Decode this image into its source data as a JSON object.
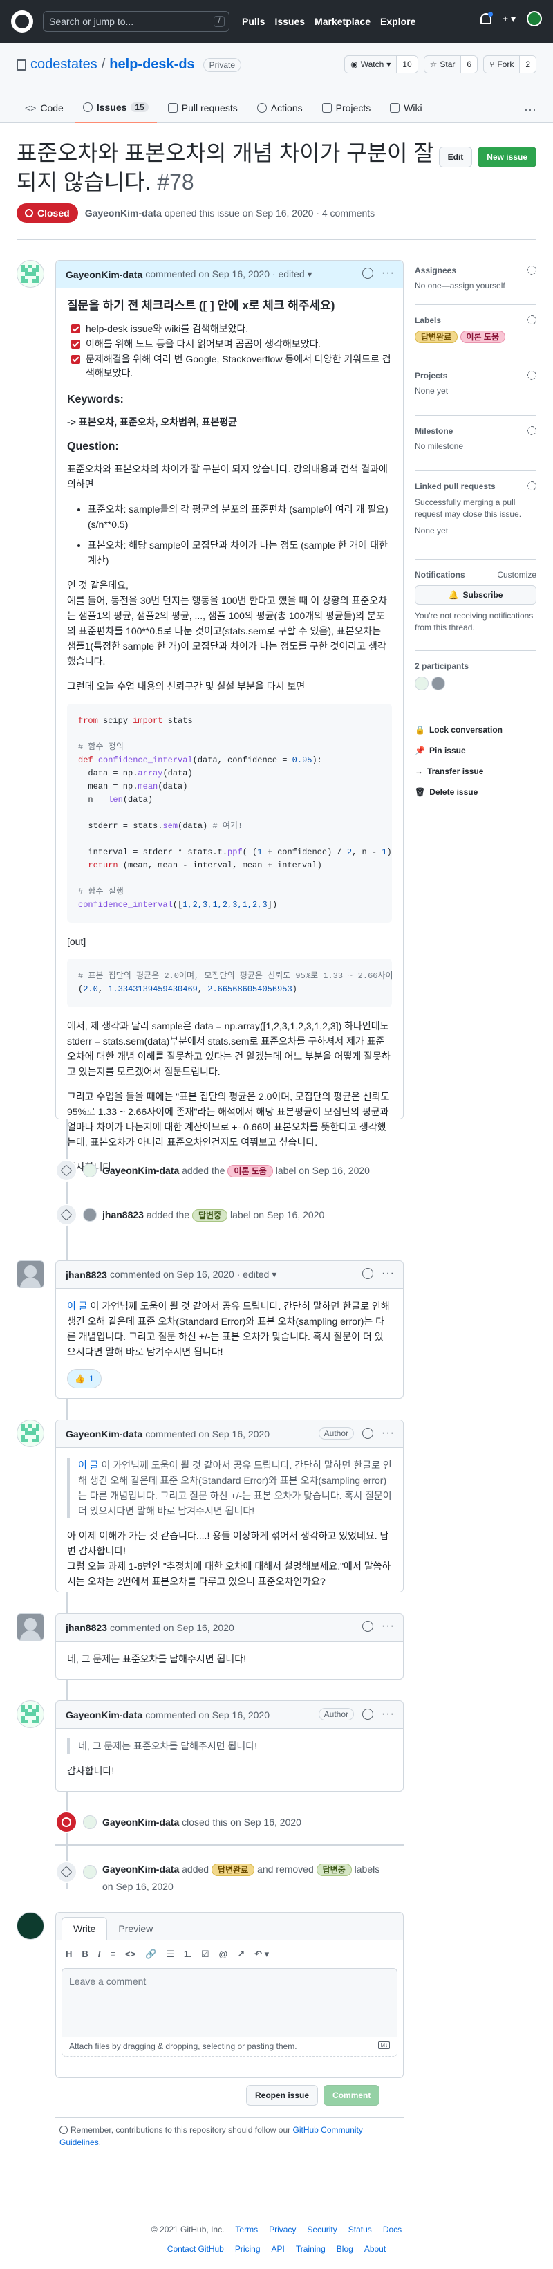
{
  "header": {
    "search_placeholder": "Search or jump to...",
    "slash": "/",
    "nav": [
      "Pulls",
      "Issues",
      "Marketplace",
      "Explore"
    ],
    "plus": "+ ▾"
  },
  "repo": {
    "owner": "codestates",
    "sep": "/",
    "name": "help-desk-ds",
    "visibility": "Private",
    "watch": "Watch",
    "watch_count": "10",
    "star": "Star",
    "star_count": "6",
    "fork": "Fork",
    "fork_count": "2",
    "tabs": [
      {
        "label": "Code"
      },
      {
        "label": "Issues",
        "count": "15"
      },
      {
        "label": "Pull requests"
      },
      {
        "label": "Actions"
      },
      {
        "label": "Projects"
      },
      {
        "label": "Wiki"
      }
    ],
    "more": "···"
  },
  "issue": {
    "title": "표준오차와 표본오차의 개념 차이가 구분이 잘 되지 않습니다.",
    "number": "#78",
    "edit": "Edit",
    "new_issue": "New issue",
    "state": "Closed",
    "opened_by": "GayeonKim-data",
    "opened_text": "opened this issue on Sep 16, 2020 · 4 comments"
  },
  "comments": [
    {
      "author": "GayeonKim-data",
      "meta": "commented on Sep 16, 2020 · edited ▾",
      "checklist_title": "질문을 하기 전 체크리스트 ([ ] 안에 x로 체크 해주세요)",
      "checklist": [
        "help-desk issue와 wiki를 검색해보았다.",
        "이해를 위해 노트 등을 다시 읽어보며 곰곰이 생각해보았다.",
        "문제해결을 위해 여러 번 Google, Stackoverflow 등에서 다양한 키워드로 검색해보았다."
      ],
      "kw_head": "Keywords:",
      "keywords": "-> 표본오차, 표준오차, 오차범위, 표본평균",
      "q_head": "Question:",
      "q1": "표준오차와 표본오차의 차이가 잘 구분이 되지 않습니다. 강의내용과 검색 결과에 의하면",
      "bullets": [
        "표준오차: sample들의 각 평균의 분포의 표준편차 (sample이 여러 개 필요) (s/n**0.5)",
        "표본오차: 해당 sample이 모집단과 차이가 나는 정도 (sample 한 개에 대한 계산)"
      ],
      "q2": "인 것 같은데요,\n예를 들어, 동전을 30번 던지는 행동을 100번 한다고 했을 때 이 상황의 표준오차는 샘플1의 평균, 샘플2의 평균, ..., 샘플 100의 평균(총 100개의 평균들)의 분포의 표준편차를 100**0.5로 나눈 것이고(stats.sem로 구할 수 있음), 표본오차는 샘플1(특정한 sample 한 개)이 모집단과 차이가 나는 정도를 구한 것이라고 생각했습니다.",
      "q3": "그런데 오늘 수업 내용의 신뢰구간 및 실설 부분을 다시 보면",
      "code": [
        [
          [
            "kw",
            "from "
          ],
          [
            "",
            "scipy "
          ],
          [
            "kw",
            "import "
          ],
          [
            "",
            "stats"
          ]
        ],
        [],
        [
          [
            "cm",
            "# 함수 정의"
          ]
        ],
        [
          [
            "kw",
            "def "
          ],
          [
            "fn",
            "confidence_interval"
          ],
          [
            "",
            "(data, confidence = "
          ],
          [
            "nm",
            "0.95"
          ],
          [
            "",
            "):"
          ]
        ],
        [
          [
            "",
            "  data = np."
          ],
          [
            "fn",
            "array"
          ],
          [
            "",
            "(data)"
          ]
        ],
        [
          [
            "",
            "  mean = np."
          ],
          [
            "fn",
            "mean"
          ],
          [
            "",
            "(data)"
          ]
        ],
        [
          [
            "",
            "  n = "
          ],
          [
            "fn",
            "len"
          ],
          [
            "",
            "(data)"
          ]
        ],
        [],
        [
          [
            "",
            "  stderr = stats."
          ],
          [
            "fn",
            "sem"
          ],
          [
            "",
            "(data) "
          ],
          [
            "cm",
            "# 여기!"
          ]
        ],
        [],
        [
          [
            "",
            "  interval = stderr * stats.t."
          ],
          [
            "fn",
            "ppf"
          ],
          [
            "",
            "( ("
          ],
          [
            "nm",
            "1"
          ],
          [
            "",
            " + confidence) / "
          ],
          [
            "nm",
            "2"
          ],
          [
            "",
            ", n - "
          ],
          [
            "nm",
            "1"
          ],
          [
            "",
            ")"
          ]
        ],
        [
          [
            "kw",
            "  return "
          ],
          [
            "",
            "(mean, mean - interval, mean + interval)"
          ]
        ],
        [],
        [
          [
            "cm",
            "# 함수 실행"
          ]
        ],
        [
          [
            "fn",
            "confidence_interval"
          ],
          [
            "",
            "(["
          ],
          [
            "nm",
            "1,2,3,1,2,3,1,2,3"
          ],
          [
            "",
            "])"
          ]
        ]
      ],
      "out_label": "[out]",
      "out_code": [
        [
          [
            "cm",
            "# 표본 집단의 평균은 2.0이며, 모집단의 평균은 신뢰도 95%로 1.33 ~ 2.66사이에"
          ]
        ],
        [
          [
            "",
            "("
          ],
          [
            "nm",
            "2.0"
          ],
          [
            "",
            ", "
          ],
          [
            "nm",
            "1.3343139459430469"
          ],
          [
            "",
            ", "
          ],
          [
            "nm",
            "2.665686054056953"
          ],
          [
            "",
            ")"
          ]
        ]
      ],
      "q4": "에서, 제 생각과 달리 sample은 data = np.array([1,2,3,1,2,3,1,2,3]) 하나인데도 stderr = stats.sem(data)부분에서 stats.sem로 표준오차를 구하셔서 제가 표준오차에 대한 개념 이해를 잘못하고 있다는 건 알겠는데 어느 부분을 어떻게 잘못하고 있는지를 모르겠어서 질문드립니다.",
      "q5": "그리고 수업을 들을 때에는 \"표본 집단의 평균은 2.0이며, 모집단의 평균은 신뢰도 95%로 1.33 ~ 2.66사이에 존재\"라는 해석에서 해당 표본평균이 모집단의 평균과 얼마나 차이가 나는지에 대한 계산이므로 +- 0.66이 표본오차를 뜻한다고 생각했는데, 표본오차가 아니라 표준오차인건지도 여쭤보고 싶습니다.",
      "q6": "감사합니다."
    },
    {
      "author": "jhan8823",
      "meta": "commented on Sep 16, 2020 · edited ▾",
      "link": "이 글",
      "text": "이 가연님께 도움이 될 것 같아서 공유 드립니다. 간단히 말하면 한글로 인해 생긴 오해 같은데 표준 오차(Standard Error)와 표본 오차(sampling error)는 다른 개념입니다. 그리고 질문 하신 +/-는 표본 오차가 맞습니다. 혹시 질문이 더 있으시다면 말해 바로 남겨주시면 됩니다!",
      "reaction": "👍",
      "reaction_count": "1"
    },
    {
      "author": "GayeonKim-data",
      "meta": "commented on Sep 16, 2020",
      "badge": "Author",
      "quote_link": "이 글",
      "quote": "이 가연님께 도움이 될 것 같아서 공유 드립니다. 간단히 말하면 한글로 인해 생긴 오해 같은데 표준 오차(Standard Error)와 표본 오차(sampling error)는 다른 개념입니다. 그리고 질문 하신 +/-는 표본 오차가 맞습니다. 혹시 질문이 더 있으시다면 말해 바로 남겨주시면 됩니다!",
      "text": "아 이제 이해가 가는 것 같습니다....! 용들 이상하게 섞어서 생각하고 있었네요. 답변 감사합니다!\n그럼 오늘 과제 1-6번인 \"추정치에 대한 오차에 대해서 설명해보세요.\"에서 말씀하시는 오차는 2번에서 표본오차를 다루고 있으니 표준오차인가요?"
    },
    {
      "author": "jhan8823",
      "meta": "commented on Sep 16, 2020",
      "text": "네, 그 문제는 표준오차를 답해주시면 됩니다!"
    },
    {
      "author": "GayeonKim-data",
      "meta": "commented on Sep 16, 2020",
      "badge": "Author",
      "quote": "네, 그 문제는 표준오차를 답해주시면 됩니다!",
      "text": "감사합니다!"
    }
  ],
  "events": {
    "e1": {
      "author": "GayeonKim-data",
      "pre": "added the",
      "label": "이론 도움",
      "post": "label on Sep 16, 2020"
    },
    "e2": {
      "author": "jhan8823",
      "pre": "added the",
      "label": "답변중",
      "post": "label on Sep 16, 2020"
    },
    "e3": {
      "author": "GayeonKim-data",
      "text": "closed this on Sep 16, 2020"
    },
    "e4": {
      "author": "GayeonKim-data",
      "pre": "added",
      "label1": "답변완료",
      "mid": "and removed",
      "label2": "답변중",
      "post": "labels",
      "date": "on Sep 16, 2020"
    }
  },
  "sidebar": {
    "assignees": "Assignees",
    "assignees_val": "No one—assign yourself",
    "labels": "Labels",
    "label_a": "답변완료",
    "label_b": "이론 도움",
    "projects": "Projects",
    "projects_val": "None yet",
    "milestone": "Milestone",
    "milestone_val": "No milestone",
    "linked": "Linked pull requests",
    "linked_desc": "Successfully merging a pull request may close this issue.",
    "linked_val": "None yet",
    "notifications": "Notifications",
    "customize": "Customize",
    "subscribe": "Subscribe",
    "notif_desc": "You're not receiving notifications from this thread.",
    "participants": "2 participants",
    "lock": "Lock conversation",
    "pin": "Pin issue",
    "transfer": "Transfer issue",
    "delete": "Delete issue"
  },
  "composer": {
    "write": "Write",
    "preview": "Preview",
    "tools": [
      "H",
      "B",
      "I",
      "≡",
      "<>",
      "🔗",
      "☰",
      "1.",
      "☑",
      "@",
      "↗",
      "↶ ▾"
    ],
    "placeholder": "Leave a comment",
    "attach": "Attach files by dragging & dropping, selecting or pasting them.",
    "reopen": "Reopen issue",
    "comment": "Comment",
    "note_pre": "Remember, contributions to this repository should follow our",
    "note_link": "GitHub Community Guidelines",
    "note_post": "."
  },
  "footer": {
    "copy": "© 2021 GitHub, Inc.",
    "row1": [
      "Terms",
      "Privacy",
      "Security",
      "Status",
      "Docs"
    ],
    "row2": [
      "Contact GitHub",
      "Pricing",
      "API",
      "Training",
      "Blog",
      "About"
    ]
  },
  "colors": {
    "closed": "#cf222e",
    "new_issue": "#2da44e",
    "tab_underline": "#fd8c73"
  }
}
